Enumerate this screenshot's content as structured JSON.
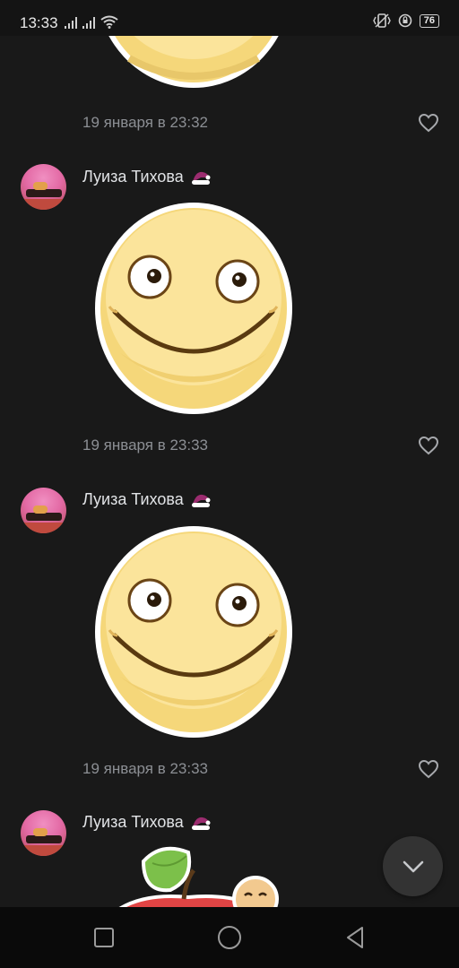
{
  "status_bar": {
    "time": "13:33",
    "battery": "76",
    "icons": [
      "signal-icon",
      "signal-icon",
      "wifi-icon",
      "vibrate-icon",
      "rotation-lock-icon",
      "battery-icon"
    ]
  },
  "messages": [
    {
      "author": "",
      "timestamp": "19 января в 23:32",
      "sticker": "smiley-sticker"
    },
    {
      "author": "Луиза Тихова",
      "timestamp": "19 января в 23:33",
      "sticker": "smiley-sticker"
    },
    {
      "author": "Луиза Тихова",
      "timestamp": "19 января в 23:33",
      "sticker": "smiley-sticker"
    },
    {
      "author": "Луиза Тихова",
      "timestamp": "",
      "sticker": "apple-sticker"
    }
  ],
  "colors": {
    "background": "#191919",
    "text": "#e1e3e6",
    "secondary_text": "#8c8f94",
    "sticker_yellow": "#f7df8a",
    "sticker_outline": "#7a4f1a"
  },
  "controls": {
    "scroll_down_icon": "chevron-down-icon",
    "nav": [
      "recent-apps-icon",
      "home-icon",
      "back-icon"
    ]
  }
}
